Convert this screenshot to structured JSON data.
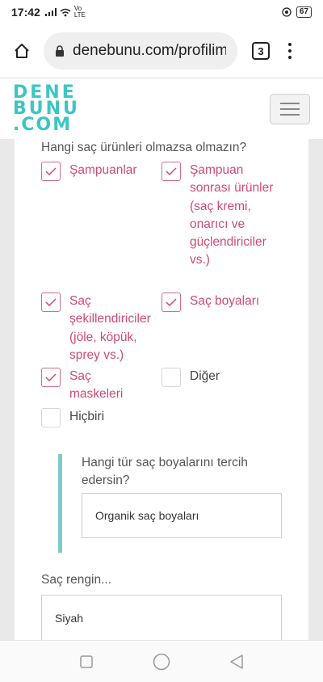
{
  "status_bar": {
    "time": "17:42",
    "network": "Vo LTE",
    "battery": "67"
  },
  "browser": {
    "url": "denebunu.com/profilim/",
    "tab_count": "3"
  },
  "site": {
    "logo_line1": "DENE",
    "logo_line2": "BUNU",
    "logo_line3": ".COM",
    "accent_color": "#3cc6c3"
  },
  "form": {
    "question": "Hangi saç ürünleri olmazsa olmazın?",
    "options": [
      {
        "label": "Şampuanlar",
        "checked": true
      },
      {
        "label": "Şampuan sonrası ürünler (saç kremi, onarıcı ve güçlendiriciler vs.)",
        "checked": true
      },
      {
        "label": "Saç şekillendiriciler (jöle, köpük, sprey vs.)",
        "checked": true
      },
      {
        "label": "Saç boyaları",
        "checked": true
      },
      {
        "label": "Saç maskeleri",
        "checked": true
      },
      {
        "label": "Diğer",
        "checked": false
      },
      {
        "label": "Hiçbiri",
        "checked": false
      }
    ],
    "sub_question": "Hangi tür saç boyalarını tercih edersin?",
    "sub_value": "Organik saç boyaları",
    "hair_color_label": "Saç rengin...",
    "hair_color_value": "Siyah",
    "checked_color": "#cf4a72"
  },
  "nav": {
    "icons": [
      "square-icon",
      "circle-icon",
      "back-triangle-icon"
    ]
  }
}
